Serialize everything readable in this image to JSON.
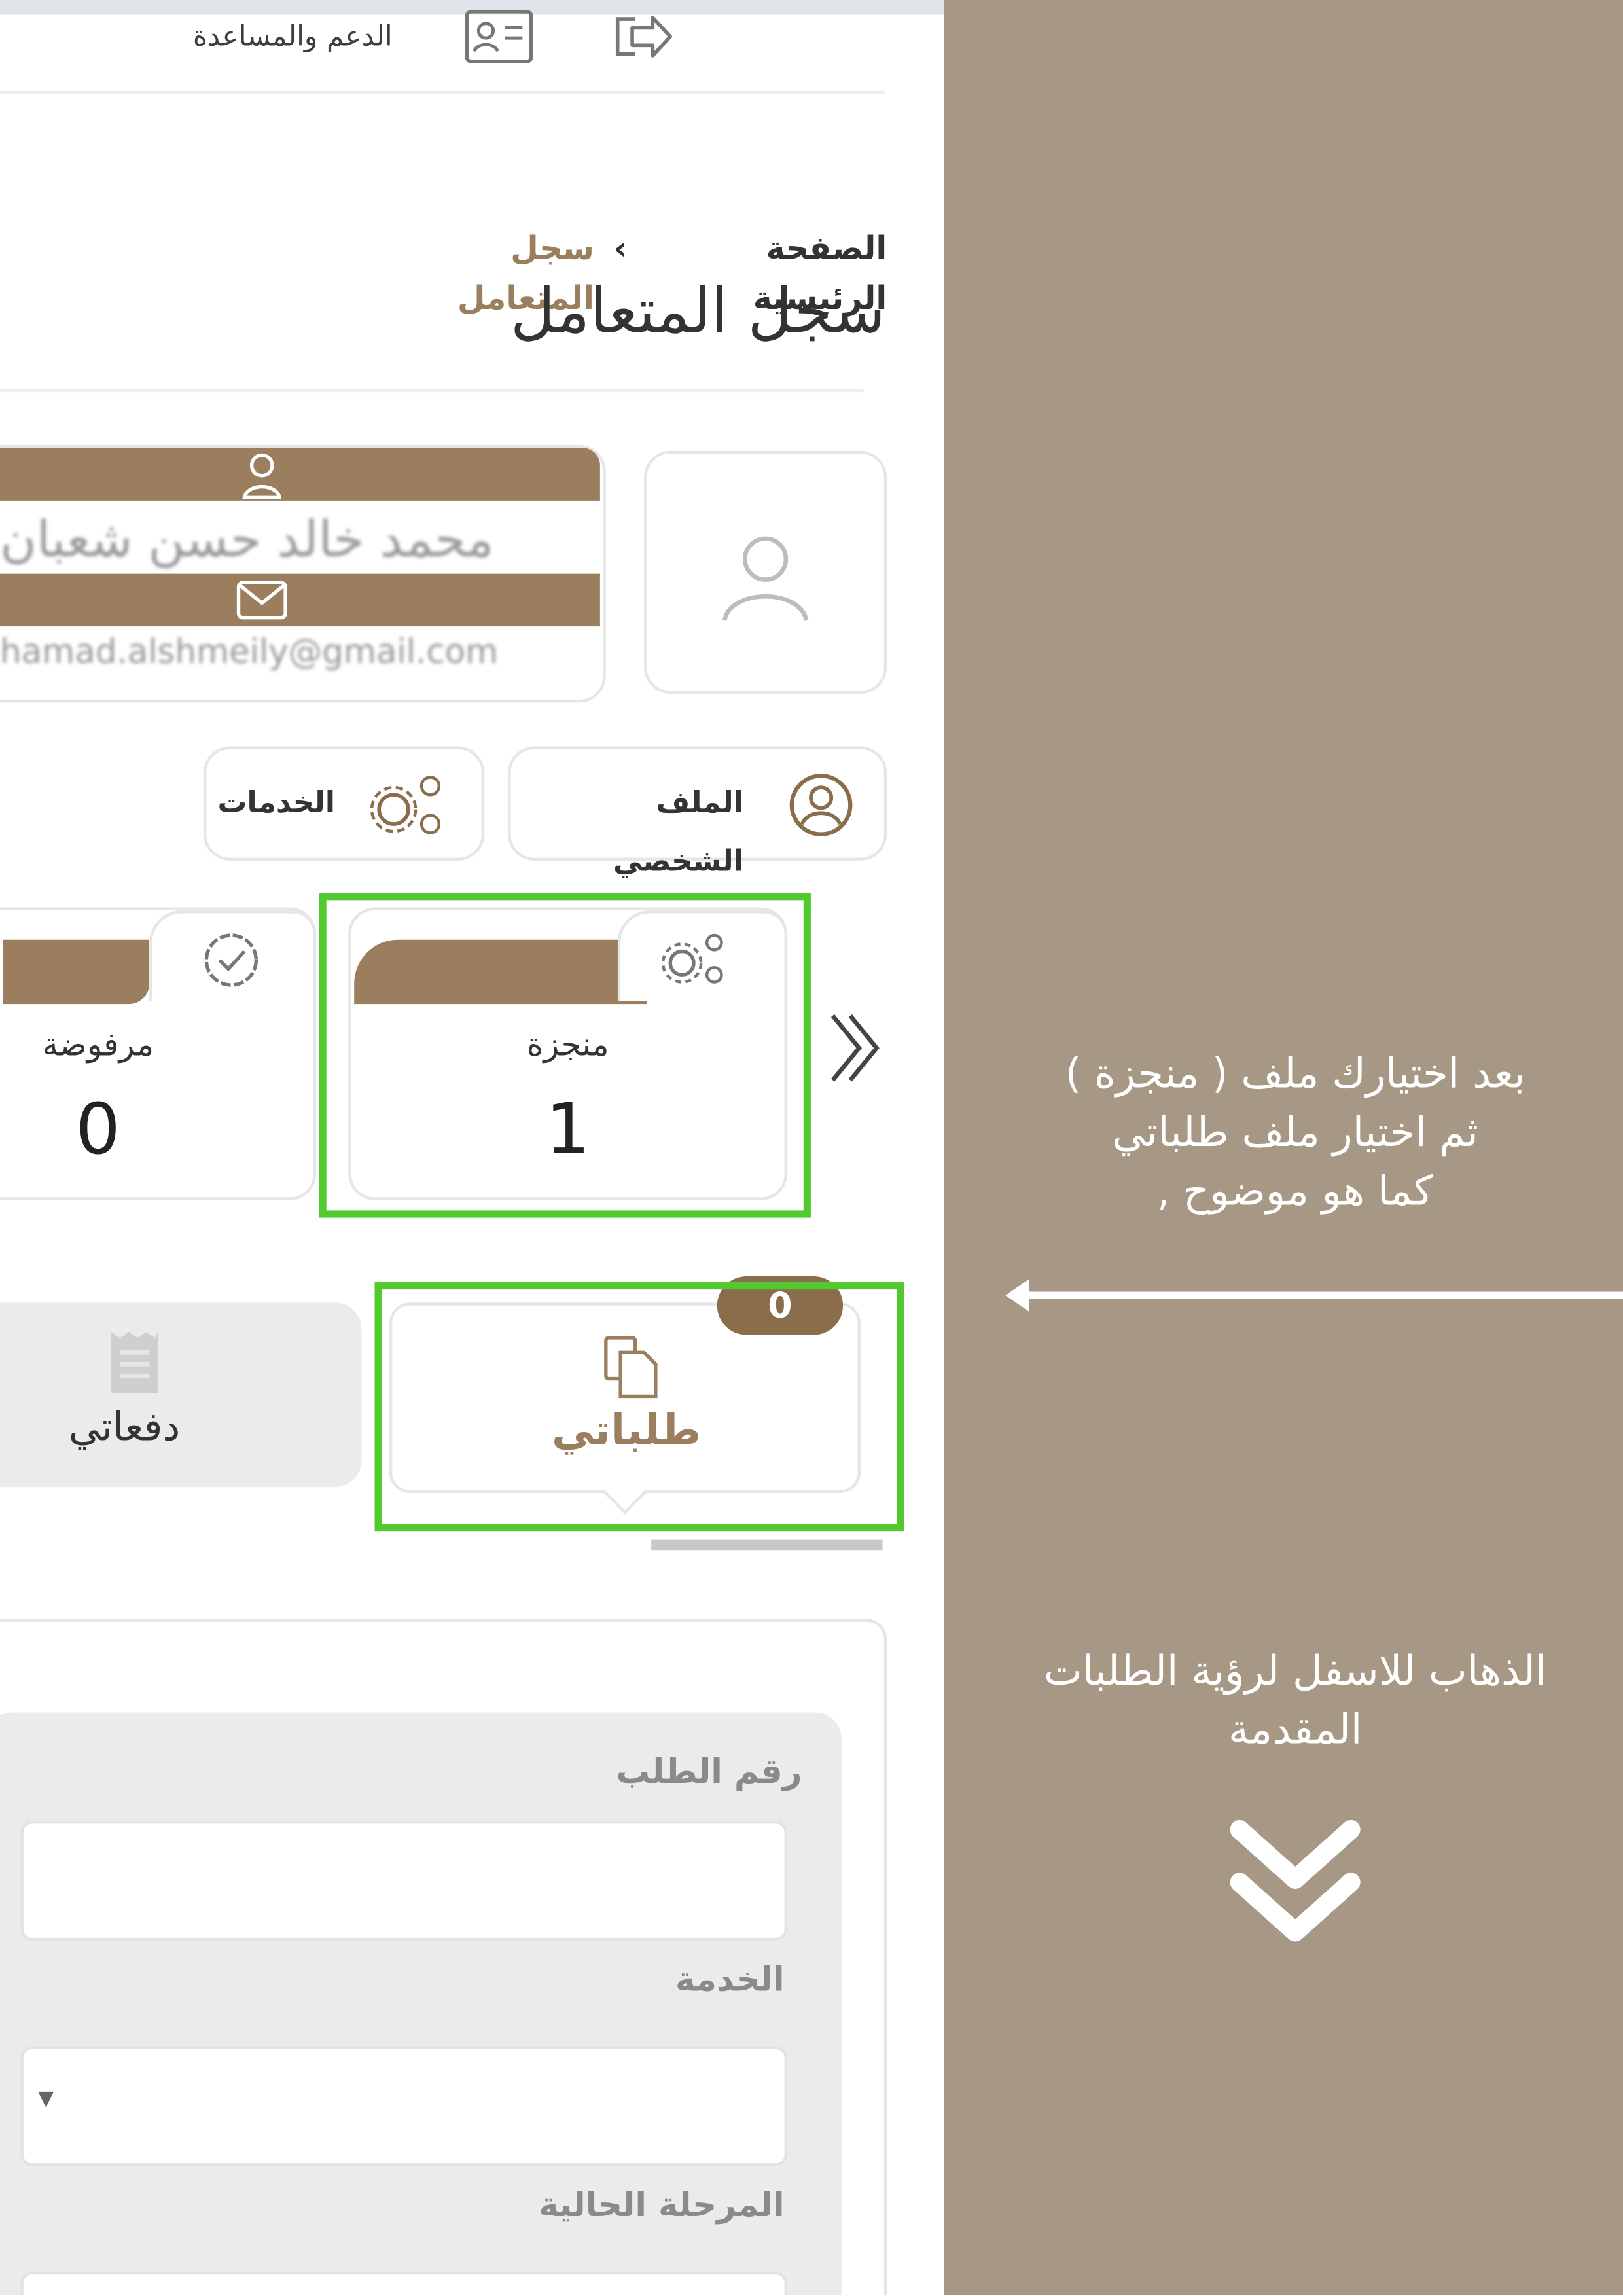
{
  "topbar": {
    "support_label": "الدعم والمساعدة",
    "profile_card_icon": "id-card-icon",
    "logout_icon": "logout-icon"
  },
  "breadcrumb": {
    "home": "الصفحة الرئيسية",
    "separator": "›",
    "current": "سجل المتعامل"
  },
  "page": {
    "title": "سجل المتعامل"
  },
  "user_card": {
    "name": "محمد خالد حسن شعبان",
    "email": "hamad.alshmeily@gmail.com",
    "avatar_icon": "user-icon",
    "user_icon": "person-icon",
    "mail_icon": "envelope-icon"
  },
  "quick_links": [
    {
      "label": "الملف الشخصي",
      "icon": "user-circle-icon"
    },
    {
      "label": "الخدمات",
      "icon": "gears-icon"
    }
  ],
  "stats": [
    {
      "label": "منجزة",
      "value": "1",
      "icon": "gears-icon"
    },
    {
      "label": "مرفوضة",
      "value": "0",
      "icon": "check-badge-icon"
    }
  ],
  "tabs": [
    {
      "label": "طلباتي",
      "badge": "0",
      "icon": "documents-icon"
    },
    {
      "label": "دفعاتي",
      "icon": "receipt-icon"
    }
  ],
  "form": {
    "request_number_label": "رقم الطلب",
    "service_label": "الخدمة",
    "current_stage_label": "المرحلة الحالية"
  },
  "instructions": {
    "step1_line1": "بعد اختيارك ملف ( منجزة )",
    "step1_line2": "ثم اختيار ملف طلباتي",
    "step1_line3": "كما هو موضوح ,",
    "step2_line1": "الذهاب للاسفل لرؤية الطلبات",
    "step2_line2": "المقدمة"
  },
  "colors": {
    "brand_brown": "#9a7e5e",
    "highlight_green": "#52c92f",
    "side_panel": "#a69885"
  }
}
